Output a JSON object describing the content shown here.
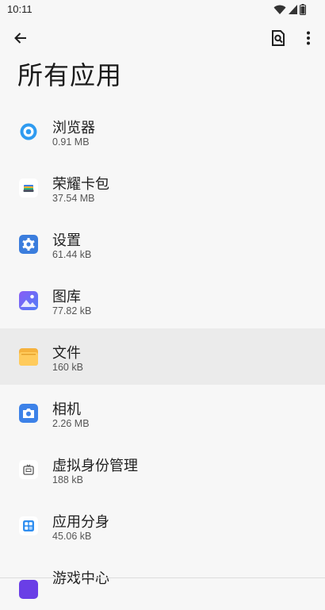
{
  "status_bar": {
    "time": "10:11"
  },
  "page": {
    "title": "所有应用"
  },
  "apps": [
    {
      "name": "浏览器",
      "size": "0.91 MB",
      "icon": "browser-icon"
    },
    {
      "name": "荣耀卡包",
      "size": "37.54 MB",
      "icon": "wallet-icon"
    },
    {
      "name": "设置",
      "size": "61.44 kB",
      "icon": "settings-gear-icon"
    },
    {
      "name": "图库",
      "size": "77.82 kB",
      "icon": "gallery-icon"
    },
    {
      "name": "文件",
      "size": "160 kB",
      "icon": "folder-icon"
    },
    {
      "name": "相机",
      "size": "2.26 MB",
      "icon": "camera-icon"
    },
    {
      "name": "虚拟身份管理",
      "size": "188 kB",
      "icon": "id-card-icon"
    },
    {
      "name": "应用分身",
      "size": "45.06 kB",
      "icon": "app-clone-icon"
    },
    {
      "name": "游戏中心",
      "size": "",
      "icon": "game-center-icon"
    }
  ]
}
